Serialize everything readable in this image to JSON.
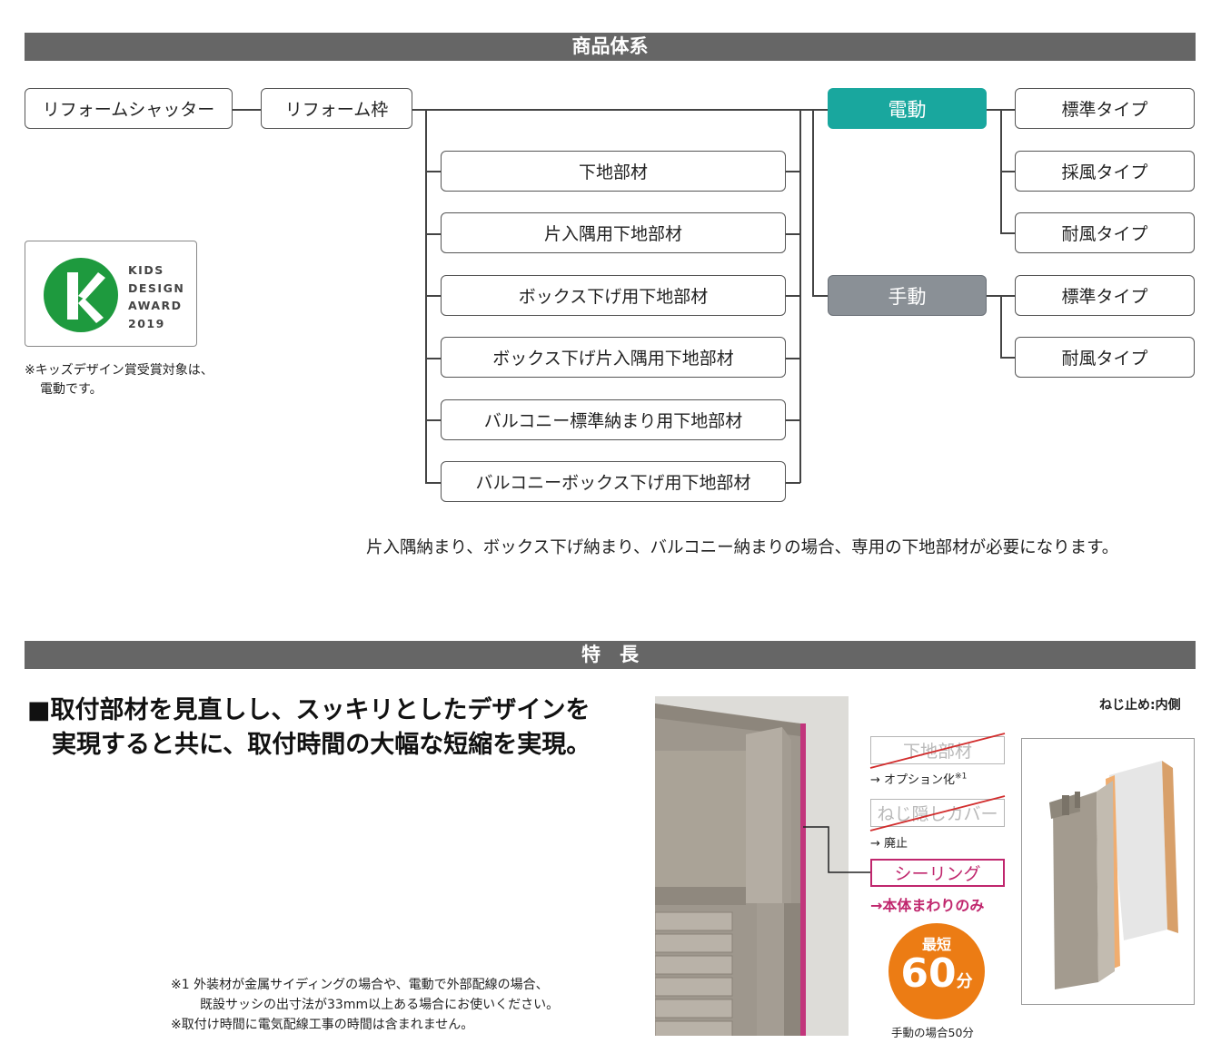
{
  "sections": {
    "lineup_title": "商品体系",
    "features_title": "特　長"
  },
  "tree": {
    "root": "リフォームシャッター",
    "frame": "リフォーム枠",
    "base_parts": [
      "下地部材",
      "片入隅用下地部材",
      "ボックス下げ用下地部材",
      "ボックス下げ片入隅用下地部材",
      "バルコニー標準納まり用下地部材",
      "バルコニーボックス下げ用下地部材"
    ],
    "electric": {
      "label": "電動",
      "types": [
        "標準タイプ",
        "採風タイプ",
        "耐風タイプ"
      ],
      "color": "#19a79e"
    },
    "manual": {
      "label": "手動",
      "types": [
        "標準タイプ",
        "耐風タイプ"
      ],
      "color": "#8a9096"
    }
  },
  "award": {
    "logo_letter": "K",
    "lines": [
      "KIDS",
      "DESIGN",
      "AWARD",
      "2019"
    ],
    "note_lines": [
      "※キッズデザイン賞受賞対象は、",
      "電動です。"
    ],
    "color": "#1e9a3e"
  },
  "lineup_note": "片入隅納まり、ボックス下げ納まり、バルコニー納まりの場合、専用の下地部材が必要になります。",
  "feature": {
    "headline_lines": [
      "■取付部材を見直しし、スッキリとしたデザインを",
      "実現すると共に、取付時間の大幅な短縮を実現。"
    ],
    "footnotes": [
      "※1 外装材が金属サイディングの場合や、電動で外部配線の場合、",
      "既設サッシの出寸法が33mm以上ある場合にお使いください。",
      "※取付け時間に電気配線工事の時間は含まれません。"
    ],
    "removed_items": [
      {
        "label": "下地部材",
        "note": "→ オプション化",
        "sup": "※1"
      },
      {
        "label": "ねじ隠しカバー",
        "note": "→ 廃止",
        "sup": ""
      }
    ],
    "sealing": {
      "label": "シーリング",
      "note": "→本体まわりのみ",
      "color": "#c0266d"
    },
    "time_badge": {
      "top": "最短",
      "number": "60",
      "unit": "分",
      "caption": "手動の場合50分",
      "color": "#ec7c14"
    },
    "screw_label": "ねじ止め:内側"
  }
}
